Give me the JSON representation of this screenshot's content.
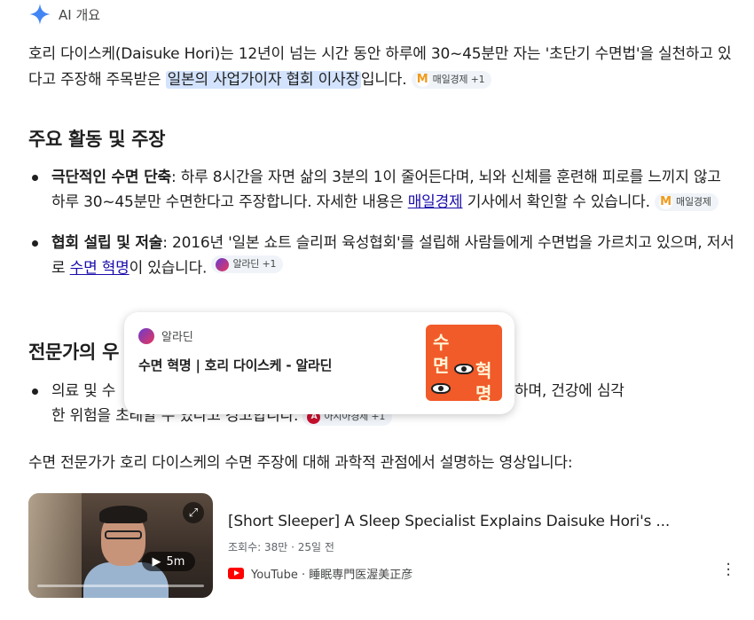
{
  "header": {
    "label": "AI 개요",
    "icon": "sparkle-icon",
    "accent": "#4285f4"
  },
  "intro": {
    "text_before": "호리 다이스케(Daisuke Hori)는 12년이 넘는 시간 동안 하루에 30~45분만 자는 '초단기 수면법'을 실천하고 있다고 주장해 주목받은 ",
    "highlight": "일본의 사업가이자 협회 이사장",
    "text_after": "입니다.",
    "chip_label": "매일경제 +1"
  },
  "section1": {
    "title": "주요 활동 및 주장",
    "bullets": [
      {
        "bold": "극단적인 수면 단축",
        "text_before": ": 하루 8시간을 자면 삶의 3분의 1이 줄어든다며, 뇌와 신체를 훈련해 피로를 느끼지 않고 하루 30~45분만 수면한다고 주장합니다. 자세한 내용은 ",
        "link": "매일경제",
        "text_after": " 기사에서 확인할 수 있습니다.",
        "chip_label": "매일경제"
      },
      {
        "bold": "협회 설립 및 저술",
        "text_before": ": 2016년 '일본 쇼트 슬리퍼 육성협회'를 설립해 사람들에게 수면법을 가르치고 있으며, 저서로 ",
        "link": "수면 혁명",
        "text_after": "이 있습니다.",
        "chip_label": "알라딘 +1"
      }
    ]
  },
  "section2": {
    "title_visible": "전문가의 우",
    "bullet_start": "의료 및 수",
    "bullet_end": "적으로 불가능하며, 건강에 심각",
    "bullet_line2": "한 위험을 초래할 수 있다고 경고합니다.",
    "chip_label": "아시아경제 +1"
  },
  "popup": {
    "source": "알라딘",
    "title": "수면 혁명 | 호리 다이스케 - 알라딘",
    "book_chars": [
      "수",
      "면",
      "혁",
      "명"
    ]
  },
  "video_intro": "수면 전문가가 호리 다이스케의 수면 주장에 대해 과학적 관점에서 설명하는 영상입니다:",
  "video": {
    "title": "[Short Sleeper] A Sleep Specialist Explains Daisuke Hori's ...",
    "views": "조회수: 38만",
    "age": "25일 전",
    "platform": "YouTube",
    "channel": "睡眠専門医渥美正彦",
    "duration": "5m"
  }
}
